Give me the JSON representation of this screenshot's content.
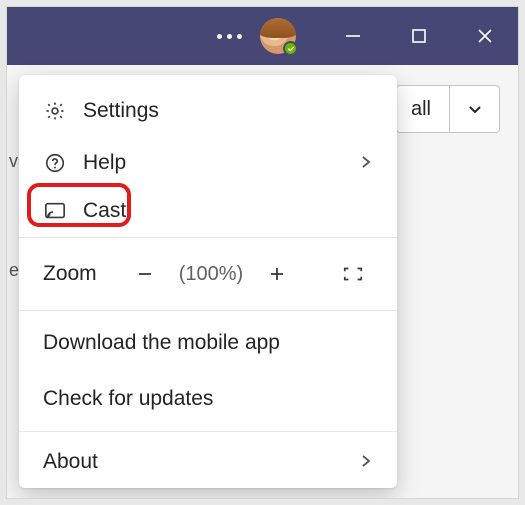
{
  "titlebar": {
    "presence_status": "available"
  },
  "underlay": {
    "call_label": "all",
    "side_letters": [
      "v",
      "e"
    ]
  },
  "menu": {
    "settings": "Settings",
    "help": "Help",
    "cast": "Cast",
    "zoom_label": "Zoom",
    "zoom_pct": "(100%)",
    "download": "Download the mobile app",
    "updates": "Check for updates",
    "about": "About"
  }
}
